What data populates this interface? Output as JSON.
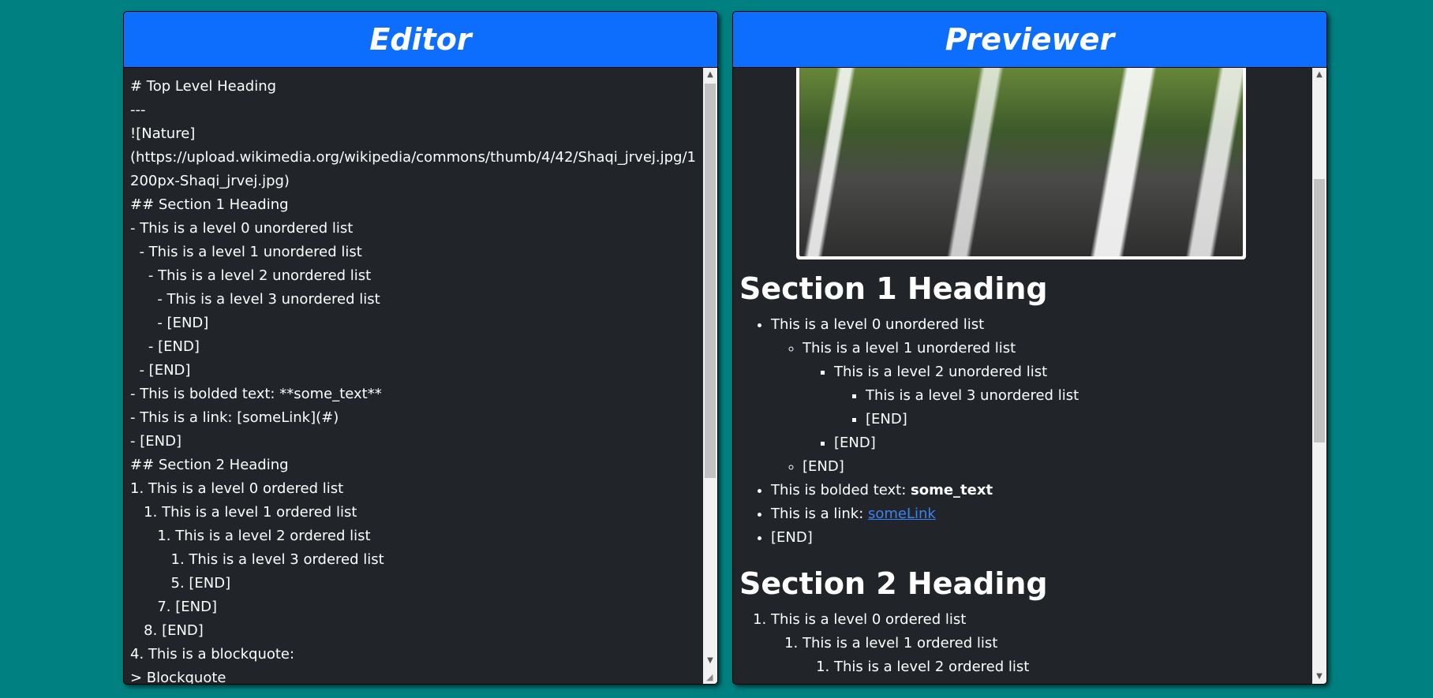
{
  "editor": {
    "title": "Editor",
    "markdown": "# Top Level Heading\n---\n![Nature]\n(https://upload.wikimedia.org/wikipedia/commons/thumb/4/42/Shaqi_jrvej.jpg/1200px-Shaqi_jrvej.jpg)\n## Section 1 Heading\n- This is a level 0 unordered list\n  - This is a level 1 unordered list\n    - This is a level 2 unordered list\n      - This is a level 3 unordered list\n      - [END]\n    - [END]\n  - [END]\n- This is bolded text: **some_text**\n- This is a link: [someLink](#)\n- [END]\n## Section 2 Heading\n1. This is a level 0 ordered list\n   1. This is a level 1 ordered list\n      1. This is a level 2 ordered list\n         1. This is a level 3 ordered list\n         5. [END]\n      7. [END]\n   8. [END]\n4. This is a blockquote:\n> Blockquote"
  },
  "previewer": {
    "title": "Previewer",
    "section1": {
      "heading": "Section 1 Heading",
      "l0_item": "This is a level 0 unordered list",
      "l1_item": "This is a level 1 unordered list",
      "l2_item": "This is a level 2 unordered list",
      "l3_item": "This is a level 3 unordered list",
      "l3_end": "[END]",
      "l2_end": "[END]",
      "l1_end": "[END]",
      "bold_prefix": "This is bolded text: ",
      "bold_text": "some_text",
      "link_prefix": "This is a link: ",
      "link_text": "someLink",
      "l0_end": "[END]"
    },
    "section2": {
      "heading": "Section 2 Heading",
      "ol0_item": "This is a level 0 ordered list",
      "ol1_item": "This is a level 1 ordered list",
      "ol2_item": "This is a level 2 ordered list"
    }
  },
  "colors": {
    "background": "#008080",
    "header": "#0d6efd",
    "panel": "#212529",
    "link": "#3b82f6"
  }
}
